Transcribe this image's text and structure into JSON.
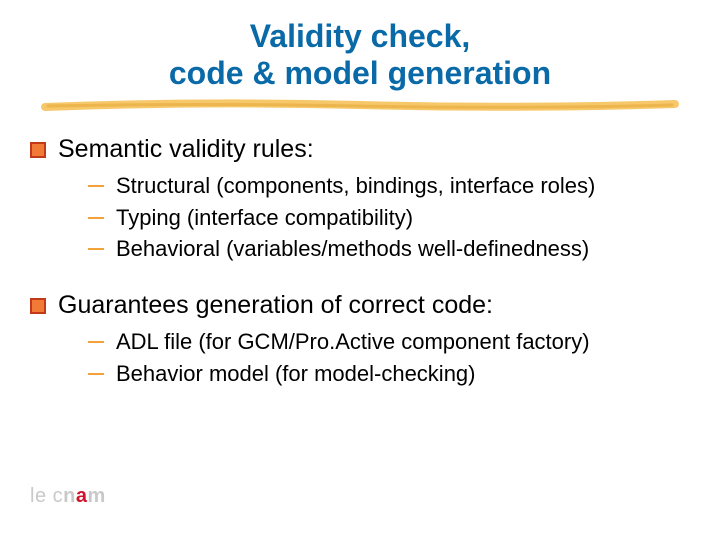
{
  "title": {
    "line1": "Validity check,",
    "line2": "code & model generation"
  },
  "sections": [
    {
      "heading": "Semantic validity rules:",
      "items": [
        "Structural (components, bindings, interface roles)",
        "Typing (interface compatibility)",
        "Behavioral (variables/methods well-definedness)"
      ]
    },
    {
      "heading": "Guarantees generation of correct code:",
      "items": [
        "ADL file (for GCM/Pro.Active component factory)",
        "Behavior model (for model-checking)"
      ]
    }
  ],
  "logo": {
    "prefix": "le ",
    "c": "c",
    "n": "n",
    "a": "a",
    "m": "m"
  }
}
